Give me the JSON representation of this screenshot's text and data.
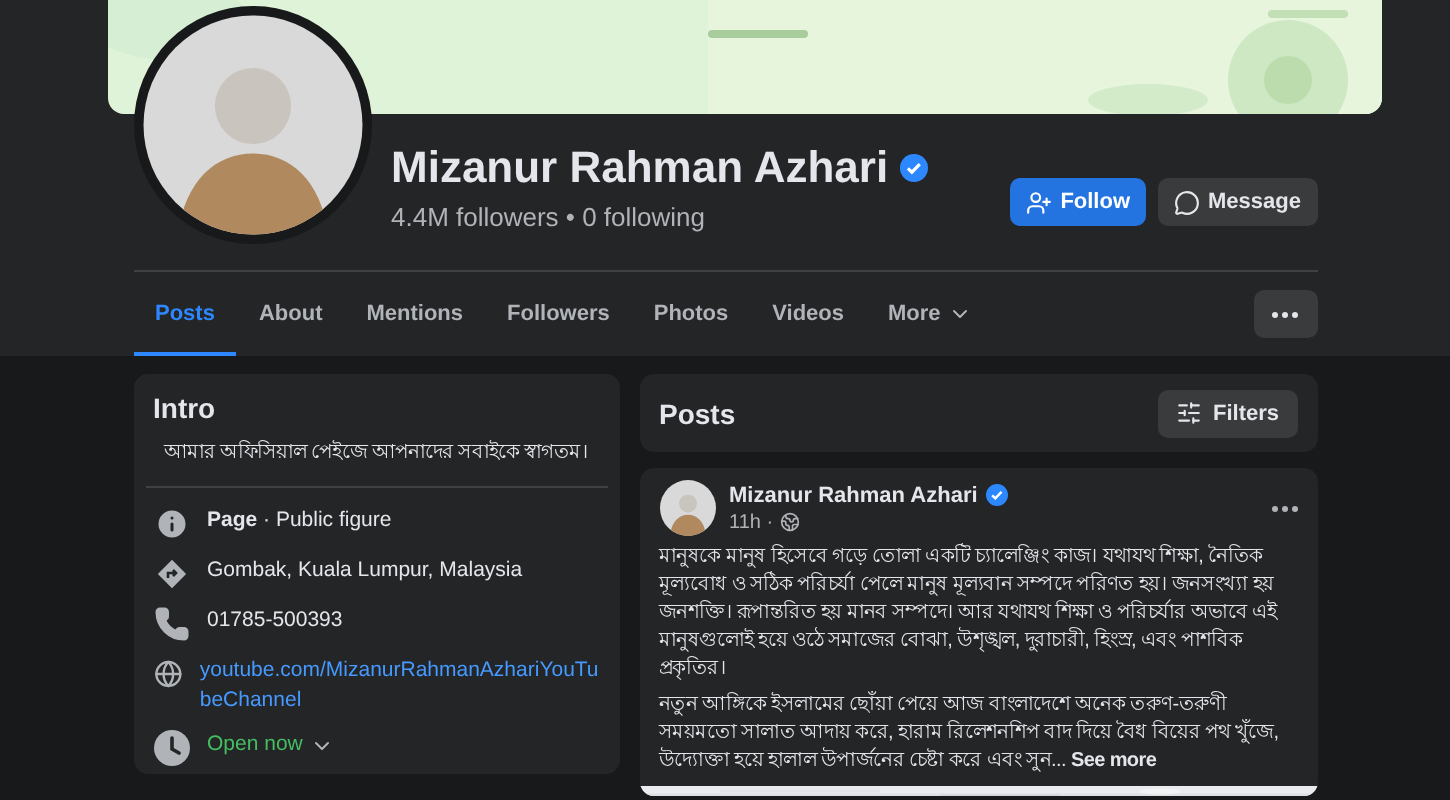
{
  "profile": {
    "name": "Mizanur Rahman Azhari",
    "verified": true,
    "stats": "4.4M followers • 0 following"
  },
  "actions": [
    {
      "label": "Follow",
      "kind": "primary"
    },
    {
      "label": "Message",
      "kind": "secondary"
    }
  ],
  "tabs": [
    {
      "label": "Posts",
      "selected": true
    },
    {
      "label": "About",
      "selected": false
    },
    {
      "label": "Mentions",
      "selected": false
    },
    {
      "label": "Followers",
      "selected": false
    },
    {
      "label": "Photos",
      "selected": false
    },
    {
      "label": "Videos",
      "selected": false
    },
    {
      "label": "More",
      "selected": false,
      "dropdown": true
    }
  ],
  "intro": {
    "title": "Intro",
    "bio": "আমার অফিসিয়াল পেইজে আপনাদের সবাইকে স্বাগতম।",
    "details": [
      {
        "kind": "info",
        "text": "**Page** · Public figure"
      },
      {
        "kind": "location",
        "text": "Gombak, Kuala Lumpur, Malaysia"
      },
      {
        "kind": "phone",
        "text": "01785-500393"
      },
      {
        "kind": "link",
        "text": "youtube.com/MizanurRahmanAzhariYouTubeChannel"
      },
      {
        "kind": "hours",
        "text": "Open now"
      }
    ]
  },
  "posts_header": {
    "title": "Posts",
    "filter_button": "Filters"
  },
  "post": {
    "author": "Mizanur Rahman Azhari",
    "verified": true,
    "time": "11h ·",
    "paragraphs": [
      "মানুষকে মানুষ হিসেবে গড়ে তোলা একটি চ্যালেঞ্জিং কাজ। যথাযথ শিক্ষা, নৈতিক মূল্যবোধ ও সঠিক পরিচর্যা পেলে মানুষ মূল্যবান সম্পদে পরিণত হয়। জনসংখ্যা হয় জনশক্তি। রূপান্তরিত হয় মানব সম্পদে। আর যথাযথ শিক্ষা ও পরিচর্যার অভাবে এই মানুষগুলোই হয়ে ওঠে সমাজের বোঝা, উশৃঙ্খল, দুরাচারী, হিংস্র, এবং পাশবিক প্রকৃতির।",
      "নতুন আঙ্গিকে ইসলামের ছোঁয়া পেয়ে আজ বাংলাদেশে অনেক তরুণ-তরুণী সময়মতো সালাত আদায় করে, হারাম রিলেশনশিপ বাদ দিয়ে বৈধ বিয়ের পথ খুঁজে, উদ্যোক্তা হয়ে হালাল উপার্জনের চেষ্টা করে এবং সুন..."
    ],
    "see_more": "See more"
  }
}
